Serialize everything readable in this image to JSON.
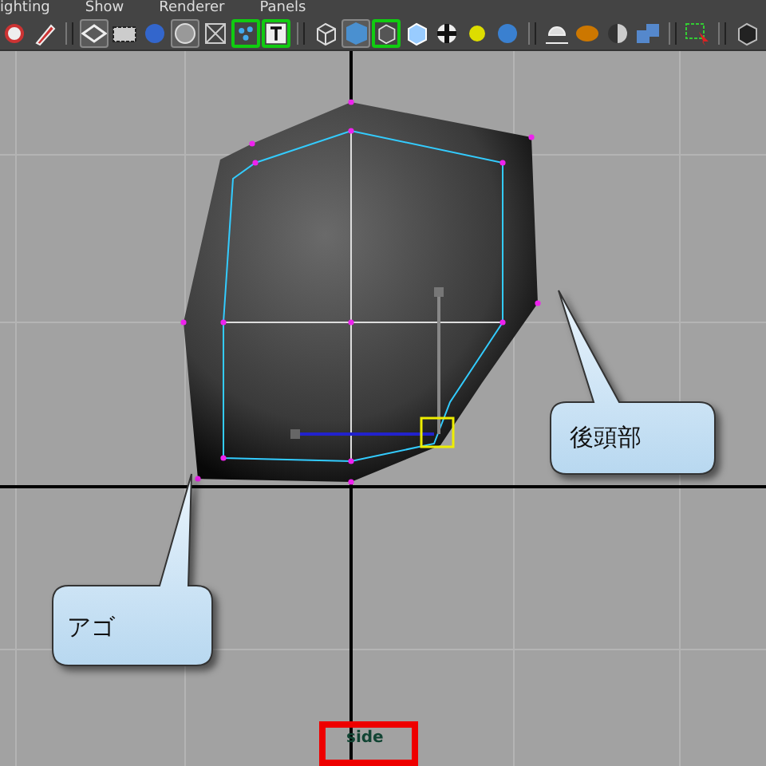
{
  "menu": [
    "ighting",
    "Show",
    "Renderer",
    "Panels"
  ],
  "toolbar": [
    {
      "kind": "button",
      "selected": false,
      "pressed": false
    },
    {
      "kind": "button",
      "selected": false,
      "pressed": false
    },
    {
      "kind": "separator"
    },
    {
      "kind": "button",
      "selected": false,
      "pressed": true
    },
    {
      "kind": "button",
      "selected": false,
      "pressed": false
    },
    {
      "kind": "button",
      "selected": false,
      "pressed": false
    },
    {
      "kind": "button",
      "selected": false,
      "pressed": true
    },
    {
      "kind": "button",
      "selected": false,
      "pressed": false
    },
    {
      "kind": "button",
      "selected": true,
      "pressed": false
    },
    {
      "kind": "button",
      "selected": true,
      "pressed": false
    },
    {
      "kind": "separator"
    },
    {
      "kind": "button",
      "selected": false,
      "pressed": false
    },
    {
      "kind": "button",
      "selected": false,
      "pressed": true
    },
    {
      "kind": "button",
      "selected": true,
      "pressed": false
    },
    {
      "kind": "button",
      "selected": false,
      "pressed": false
    },
    {
      "kind": "button",
      "selected": false,
      "pressed": false
    },
    {
      "kind": "button",
      "selected": false,
      "pressed": false
    },
    {
      "kind": "button",
      "selected": false,
      "pressed": false
    },
    {
      "kind": "separator"
    },
    {
      "kind": "button",
      "selected": false,
      "pressed": false
    },
    {
      "kind": "button",
      "selected": false,
      "pressed": false
    },
    {
      "kind": "button",
      "selected": false,
      "pressed": false
    },
    {
      "kind": "button",
      "selected": false,
      "pressed": false
    },
    {
      "kind": "separator"
    },
    {
      "kind": "button",
      "selected": false,
      "pressed": false
    },
    {
      "kind": "separator"
    },
    {
      "kind": "button",
      "selected": false,
      "pressed": false
    }
  ],
  "viewport": {
    "camera_label": "side",
    "callouts": [
      {
        "text": "後頭部"
      },
      {
        "text": "アゴ"
      }
    ]
  }
}
